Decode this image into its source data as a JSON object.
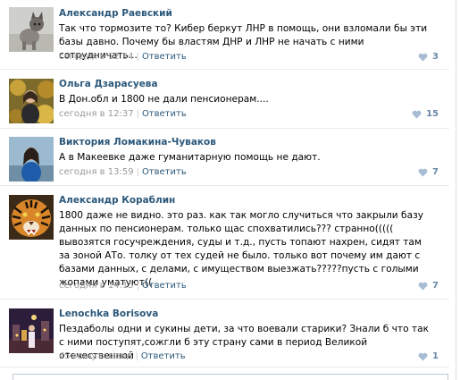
{
  "comments": [
    {
      "author": "Александр Раевский",
      "text": "Так что тормозите то? Кибер беркут ЛНР в помощь, они взломали бы эти базы давно. Почему бы властям ДНР и ЛНР не начать с ними сотрудничать...",
      "time": "сегодня в 12:34",
      "sep": "|",
      "reply": "Ответить",
      "likes": "3",
      "avatar": "cat-avatar"
    },
    {
      "author": "Ольга Дзарасуева",
      "text": "В Дон.обл и 1800 не дали пенсионерам....",
      "time": "сегодня в 12:37",
      "sep": "|",
      "reply": "Ответить",
      "likes": "15",
      "avatar": "woman-autumn-avatar"
    },
    {
      "author": "Виктория Ломакина-Чуваков",
      "text": "А в Макеевке даже гуманитарную помощь не дают.",
      "time": "сегодня в 13:59",
      "sep": "|",
      "reply": "Ответить",
      "likes": "7",
      "avatar": "woman-blue-avatar"
    },
    {
      "author": "Александр Кораблин",
      "text": "1800 даже не видно. это раз. как так могло случиться что закрыли базу данных по пенсионерам. только щас спохватились??? странно((((( вывозятся госучреждения, суды и т.д., пусть топают нахрен, сидят там за зоной АТо. толку от тех судей не было. только вот почему им дают с базами данных, с делами, с имуществом выезжать?????пусть с голыми жопами уматуют((",
      "time": "сегодня в 14:15",
      "sep": "|",
      "reply": "Ответить",
      "likes": "7",
      "avatar": "tiger-avatar"
    },
    {
      "author": "Lenochka Borisova",
      "text": "Пездаболы одни и сукины дети, за что воевали старики? Знали б что так с ними поступят,сожгли б эту страну сами в период Великой отечественной",
      "time": "45 минут назад",
      "sep": "|",
      "reply": "Ответить",
      "likes": "1",
      "avatar": "city-night-avatar"
    }
  ],
  "colors": {
    "link": "#2b587a",
    "meta": "#999999",
    "likes": "#6a86a8",
    "divider": "#e7eaed"
  }
}
